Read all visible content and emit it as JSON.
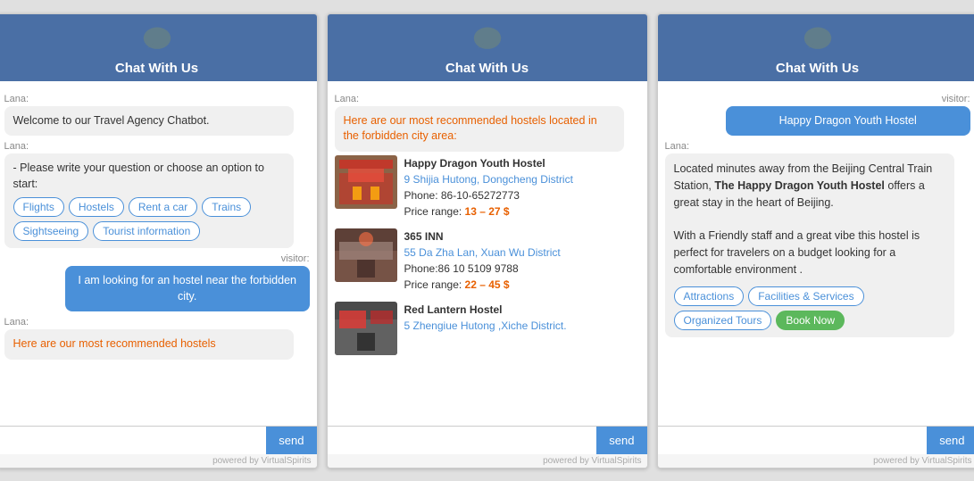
{
  "header": {
    "title": "Chat With Us"
  },
  "panel1": {
    "lana_label": "Lana:",
    "welcome_msg": "Welcome to our Travel Agency Chatbot.",
    "options_msg": "- Please write your question or choose an option to start:",
    "buttons": [
      "Flights",
      "Hostels",
      "Rent a car",
      "Trains",
      "Sightseeing",
      "Tourist information"
    ],
    "visitor_label": "visitor:",
    "visitor_msg": "I am looking for an hostel near the forbidden city.",
    "lana2_label": "Lana:",
    "lana2_msg": "Here are our most recommended hostels",
    "input_placeholder": "",
    "send_label": "send",
    "powered": "powered by VirtualSpirits"
  },
  "panel2": {
    "lana_label": "Lana:",
    "intro": "Here are our most recommended hostels located in the forbidden city area:",
    "hostels": [
      {
        "name": "Happy Dragon Youth Hostel",
        "address": "9 Shijia Hutong, Dongcheng District",
        "phone": "Phone: 86-10-65272773",
        "price_label": "Price range: ",
        "price": "13 – 27 $"
      },
      {
        "name": "365 INN",
        "address": "55 Da Zha Lan, Xuan Wu District",
        "phone": "Phone:86 10 5109 9788",
        "price_label": "Price range: ",
        "price": "22 – 45 $"
      },
      {
        "name": "Red Lantern Hostel",
        "address": "5 Zhengiue Hutong ,Xiche District.",
        "phone": "",
        "price_label": "",
        "price": ""
      }
    ],
    "send_label": "send",
    "powered": "powered by VirtualSpirits"
  },
  "panel3": {
    "visitor_label": "visitor:",
    "visitor_msg": "Happy Dragon Youth Hostel",
    "lana_label": "Lana:",
    "desc1": "Located minutes away from the Beijing Central Train Station, ",
    "bold1": "The Happy Dragon Youth Hostel",
    "desc2": " offers a great stay in the heart of Beijing.",
    "desc3": "With a Friendly staff and a great vibe this hostel is perfect for travelers on a budget looking for a comfortable environment .",
    "buttons": [
      "Attractions",
      "Facilities & Services",
      "Organized Tours",
      "Book Now"
    ],
    "send_label": "send",
    "powered": "powered by VirtualSpirits"
  },
  "icons": {
    "chat_bubble": "💬"
  }
}
